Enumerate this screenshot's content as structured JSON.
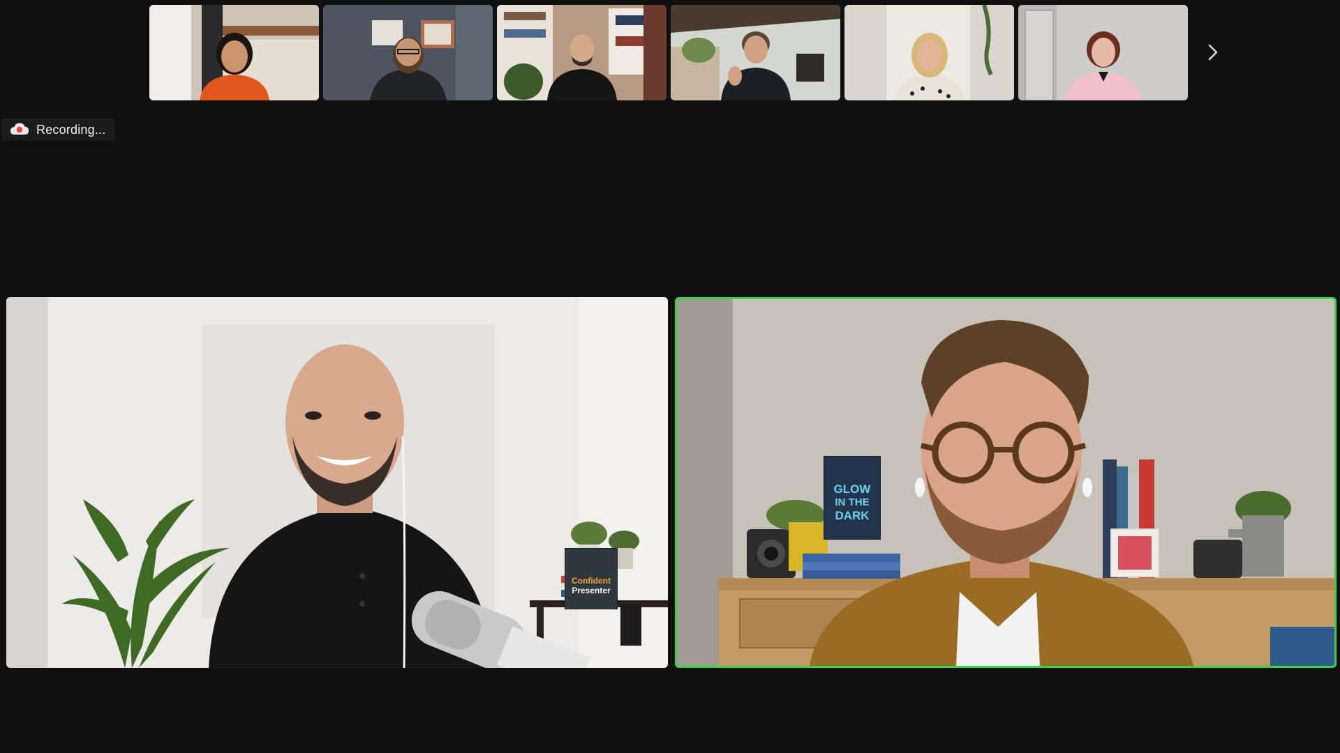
{
  "recording": {
    "label": "Recording..."
  },
  "thumbnails": [
    {
      "bg": "#cfc4b6",
      "wall": "#e6ddd3",
      "shirt": "#e0561f",
      "skin": "#c9946e",
      "hair": "#1b1512"
    },
    {
      "bg": "#4d5560",
      "wall": "#6b7480",
      "shirt": "#222325",
      "skin": "#c79675",
      "hair": "#5b3d25"
    },
    {
      "bg": "#b79a83",
      "wall": "#e9e2d8",
      "shirt": "#141414",
      "skin": "#d5a888",
      "hair": "#d5a888"
    },
    {
      "bg": "#d4d6d2",
      "wall": "#eeeeea",
      "shirt": "#1c1f24",
      "skin": "#d0a283",
      "hair": "#5a4634"
    },
    {
      "bg": "#dad6cf",
      "wall": "#ece9e3",
      "shirt": "#e8e2d8",
      "skin": "#e3b598",
      "hair": "#d7b878"
    },
    {
      "bg": "#cfcdcb",
      "wall": "#e1dfdc",
      "shirt": "#f0c1c9",
      "skin": "#e6bba6",
      "hair": "#6b2d20"
    }
  ],
  "main": {
    "left_speaker": {
      "book_title_line1": "Confident",
      "book_title_line2": "Presenter"
    },
    "right_speaker": {
      "book_title_line1": "GLOW",
      "book_title_line2": "IN THE",
      "book_title_line3": "DARK"
    },
    "active_speaker_border": "#3bd14a"
  },
  "icons": {
    "recording": "cloud-recording-icon",
    "next": "chevron-right-icon"
  }
}
